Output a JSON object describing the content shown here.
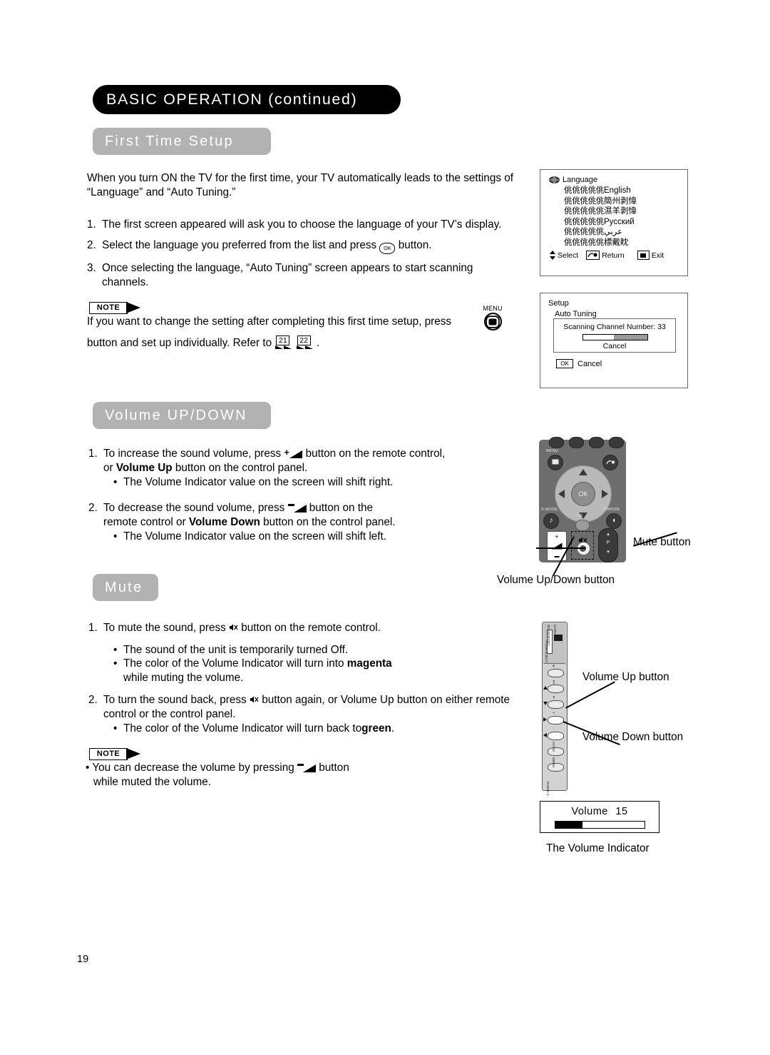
{
  "header": {
    "chapter_title": "BASIC OPERATION (continued)"
  },
  "sections": {
    "first_time_setup": {
      "pill_label": "First Time Setup",
      "intro": "When you turn ON the TV for the first time, your TV automatically leads to the settings of “Language” and “Auto Tuning.”",
      "step1_num": "1.",
      "step1_text": "The first screen appeared will ask you to choose the language of your TV’s display.",
      "step2_num": "2.",
      "step2_a": "Select the language you preferred from the list and press",
      "step2_ok": "OK",
      "step2_b": "button.",
      "step3_num": "3.",
      "step3_text": "Once selecting the language, “Auto Tuning” screen appears to start scanning channels.",
      "note_label": "NOTE",
      "note_a": "If you want to change the setting after completing this first time setup, press",
      "note_b": "button and set up individually. Refer to",
      "note_ref1": "21",
      "note_ref2": "22",
      "note_c": ".",
      "menu_icon_label": "MENU"
    },
    "volume_updown": {
      "pill_label": "Volume UP/DOWN",
      "step1_num": "1.",
      "step1_a": "To increase the sound volume, press",
      "step1_b": "button on the remote control,",
      "step1_c": "or",
      "step1_bold": "Volume Up",
      "step1_d": "button on the control panel.",
      "step1_bullet": "The Volume Indicator value on the screen will shift right.",
      "step2_num": "2.",
      "step2_a": "To decrease the sound volume, press",
      "step2_b": "button on the",
      "step2_c": "remote control or",
      "step2_bold": "Volume Down",
      "step2_d": "button on the control panel.",
      "step2_bullet": "The Volume Indicator value on the screen will shift left."
    },
    "mute": {
      "pill_label": "Mute",
      "step1_num": "1.",
      "step1_a": "To mute the sound, press",
      "step1_b": "button on the remote control.",
      "step1_bullet1": "The sound of the unit is temporarily turned Off.",
      "step1_bullet2_a": "The color of the Volume Indicator will turn into",
      "step1_bullet2_bold": "magenta",
      "step1_bullet2_b": "while muting the volume.",
      "step2_num": "2.",
      "step2_a": "To turn the sound back, press",
      "step2_b": "button again, or Volume Up button on either remote control or the control panel.",
      "step2_bullet_a": "The color of the Volume Indicator will turn back to",
      "step2_bullet_bold": "green",
      "step2_bullet_b": ".",
      "note_label": "NOTE",
      "note_a": "• You can decrease the volume by pressing",
      "note_b": "button",
      "note_c": "while muted the volume."
    }
  },
  "osd_language": {
    "title": "Language",
    "rows": [
      {
        "prefix": "佻佻佻佻佻",
        "name": "English"
      },
      {
        "prefix": "佻佻佻佻佻",
        "name": "簡州剥愇"
      },
      {
        "prefix": "佻佻佻佻佻",
        "name": "濕羊剥愇"
      },
      {
        "prefix": "佻佻佻佻佻",
        "name": "Русский"
      },
      {
        "prefix": "佻佻佻佻佻",
        "name": "عربي"
      },
      {
        "prefix": "佻佻佻佻佻",
        "name": "標戴眈"
      }
    ],
    "footer": {
      "select": "Select",
      "return": "Return",
      "exit": "Exit"
    }
  },
  "osd_setup": {
    "title": "Setup",
    "subtitle": "Auto Tuning",
    "scanning_label": "Scanning Channel Number:",
    "scanning_value": "33",
    "progress_percent": 52,
    "inner_cancel": "Cancel",
    "ok_key": "OK",
    "ok_cancel": "Cancel"
  },
  "remote": {
    "menu_label": "MENU",
    "ok_label": "OK",
    "smode_label": "S.MODE",
    "pmode_label": "P.MODE",
    "iii_label": "I/II",
    "p_label": "P",
    "callouts": {
      "mute": "Mute button",
      "volume": "Volume Up/Down button"
    }
  },
  "control_panel": {
    "sd_label_1": "SD MEMORY",
    "sd_label_2": "CARD",
    "push_eject": "PUSH-EJECT",
    "btn_power": "Φ",
    "btn_p_up": "P+",
    "btn_p_down": "P-",
    "btn_vol_up": "+",
    "btn_vol_down": "-",
    "btn_av": "AV/OK",
    "btn_menu": "MENU",
    "model_code": "PH930-1",
    "callouts": {
      "volume_up": "Volume Up button",
      "volume_down": "Volume Down button"
    }
  },
  "volume_indicator": {
    "label": "Volume",
    "value": "15",
    "fill_percent": 30,
    "caption": "The Volume Indicator"
  },
  "page_number": "19",
  "colors": {
    "banner_bg": "#000000",
    "pill_bg": "#b2b2b2",
    "pill_text": "#ffffff",
    "remote_body": "#6d6d6d",
    "control_panel_body": "#d2d2d2"
  }
}
